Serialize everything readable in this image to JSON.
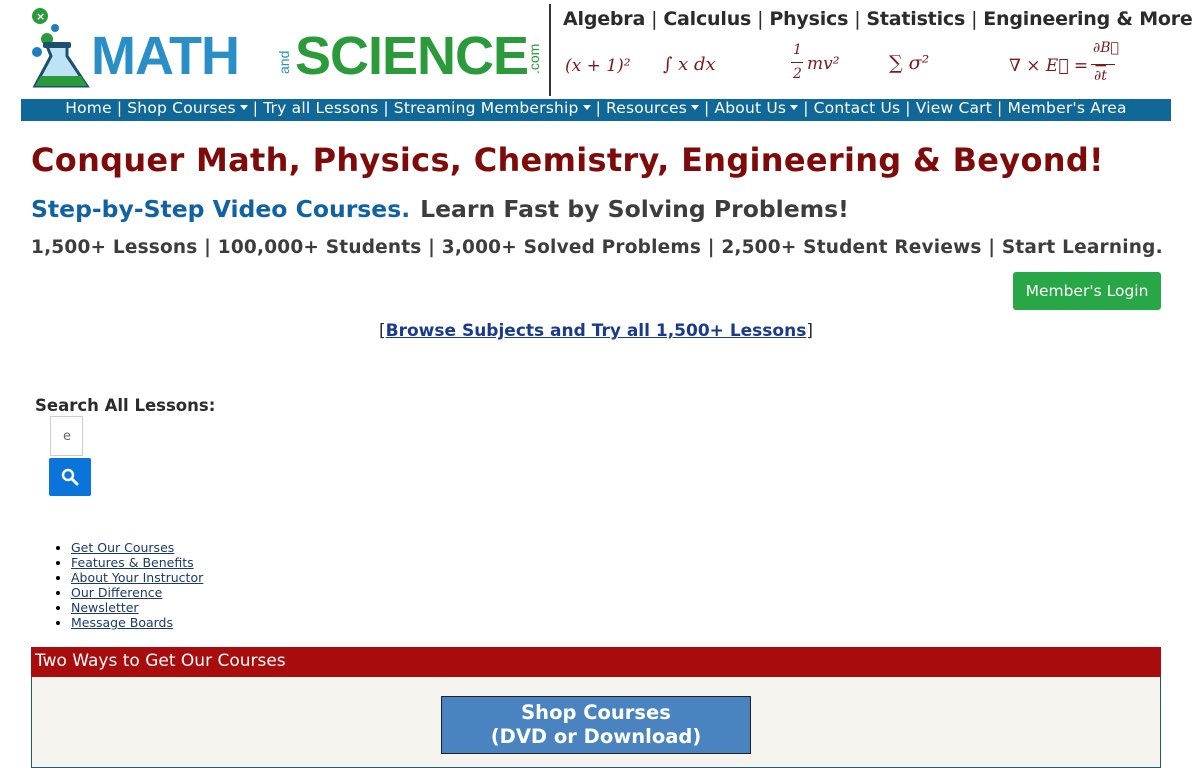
{
  "header": {
    "logo_text": "MATH and SCIENCE .com",
    "subjects": [
      "Algebra",
      "Calculus",
      "Physics",
      "Statistics",
      "Engineering & More!"
    ],
    "separator": "|",
    "formulas": {
      "algebra": "(x + 1)²",
      "calculus": "∫ x dx",
      "physics_half": "1",
      "physics_two": "2",
      "physics_rest": "mv²",
      "statistics": "∑ σ²",
      "engineering_lhs": "∇ × E⃗ = −",
      "engineering_num": "∂B⃗",
      "engineering_den": "∂t"
    }
  },
  "nav": {
    "items": [
      {
        "label": "Home",
        "dropdown": false
      },
      {
        "label": "Shop Courses",
        "dropdown": true
      },
      {
        "label": "Try all Lessons",
        "dropdown": false
      },
      {
        "label": "Streaming Membership",
        "dropdown": true
      },
      {
        "label": "Resources",
        "dropdown": true
      },
      {
        "label": "About Us",
        "dropdown": true
      },
      {
        "label": "Contact Us",
        "dropdown": false
      },
      {
        "label": "View Cart",
        "dropdown": false
      },
      {
        "label": "Member's Area",
        "dropdown": false
      }
    ],
    "separator": "|"
  },
  "hero": {
    "headline": "Conquer Math, Physics, Chemistry, Engineering & Beyond!",
    "sub_blue": "Step-by-Step Video Courses.",
    "sub_gray": "Learn Fast by Solving Problems!",
    "stats": "1,500+ Lessons | 100,000+ Students | 3,000+ Solved Problems | 2,500+ Student Reviews | Start Learning."
  },
  "login": {
    "label": "Member's Login"
  },
  "browse": {
    "open": "[",
    "link": "Browse Subjects and Try all 1,500+ Lessons",
    "close": "]"
  },
  "search": {
    "label": "Search All Lessons:",
    "value": "e"
  },
  "quick_links": [
    "Get Our Courses",
    "Features & Benefits",
    "About Your Instructor",
    "Our Difference",
    "Newsletter",
    "Message Boards"
  ],
  "courses_panel": {
    "heading": "Two Ways to Get Our Courses",
    "shop_line1": "Shop Courses",
    "shop_line2": "(DVD or Download)"
  },
  "colors": {
    "nav_bg": "#0f6897",
    "headline": "#7e0a0a",
    "sub_blue": "#1162a3",
    "login_green": "#27a745",
    "search_blue": "#0a74da",
    "panel_red": "#a80c0c",
    "shop_blue": "#4a84c0"
  },
  "icons": {
    "search_button": "search-icon",
    "logo": "flask-icon"
  }
}
